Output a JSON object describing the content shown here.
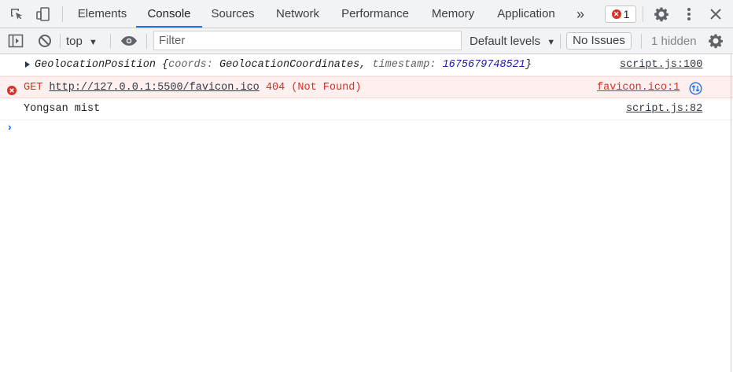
{
  "tabs": [
    "Elements",
    "Console",
    "Sources",
    "Network",
    "Performance",
    "Memory",
    "Application"
  ],
  "more_tabs": "»",
  "error_badge_count": "1",
  "toolbar": {
    "context": "top",
    "filter_placeholder": "Filter",
    "levels": "Default levels",
    "issues": "No Issues",
    "hidden": "1 hidden"
  },
  "messages": [
    {
      "type": "log",
      "object_name": "GeolocationPosition",
      "open_brace": "{",
      "key1": "coords:",
      "val1": "GeolocationCoordinates,",
      "key2": "timestamp:",
      "val2": "1675679748521",
      "close_brace": "}",
      "source": "script.js:100"
    },
    {
      "type": "error",
      "method": "GET",
      "url": "http://127.0.0.1:5500/favicon.ico",
      "status": "404 (Not Found)",
      "source": "favicon.ico:1"
    },
    {
      "type": "log",
      "text": "Yongsan mist",
      "source": "script.js:82"
    }
  ],
  "prompt_symbol": "›",
  "colors": {
    "accent": "#1a73e8",
    "error": "#d93025",
    "error_bg": "#fff0f0"
  }
}
